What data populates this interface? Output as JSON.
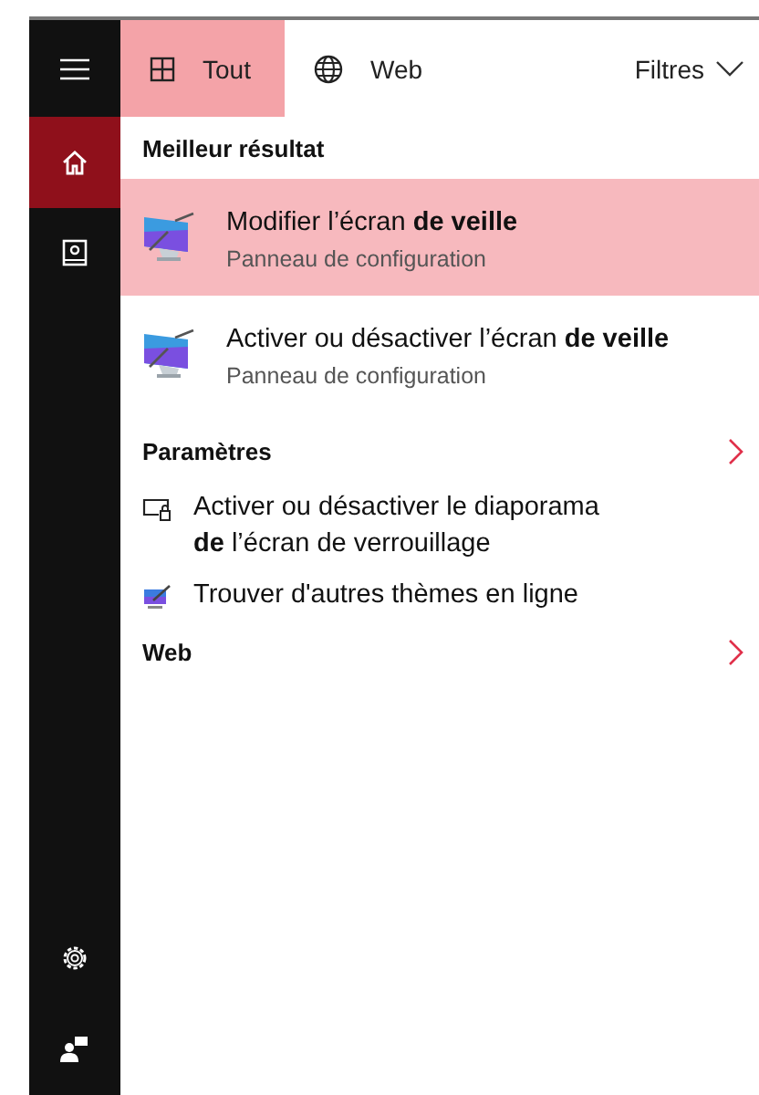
{
  "rail": {
    "items": [
      {
        "kind": "home",
        "selected": true
      },
      {
        "kind": "notebook",
        "selected": false
      }
    ],
    "bottom": [
      {
        "kind": "settings"
      },
      {
        "kind": "feedback"
      }
    ]
  },
  "tabs": [
    {
      "kind": "all",
      "label": "Tout",
      "selected": true
    },
    {
      "kind": "web",
      "label": "Web",
      "selected": false
    }
  ],
  "filter": {
    "label": "Filtres"
  },
  "sections": [
    {
      "title": "Meilleur résultat",
      "chevron": false,
      "items": [
        {
          "kind": "app",
          "title": "Modifier l’écran **de veille**",
          "subtitle": "Panneau de configuration",
          "selected": true
        },
        {
          "kind": "app",
          "title": "Activer ou désactiver l’écran **de veille**",
          "subtitle": "Panneau de configuration",
          "selected": false
        }
      ]
    },
    {
      "title": "Paramètres",
      "chevron": true,
      "items": [
        {
          "kind": "lockscreen",
          "title": "Activer ou désactiver le diaporama **de** l’écran de verrouillage",
          "selected": false
        },
        {
          "kind": "theme",
          "title": "Trouver d'autres thèmes en ligne",
          "selected": false
        }
      ]
    },
    {
      "title": "Web",
      "chevron": true
    }
  ]
}
